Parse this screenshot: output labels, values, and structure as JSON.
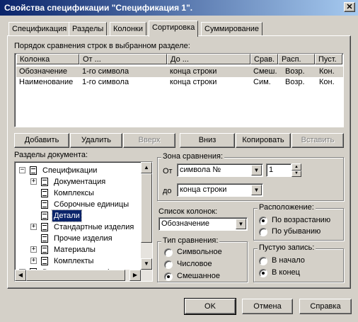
{
  "window": {
    "title": "Свойства спецификации \"Спецификация 1\".",
    "close_glyph": "✕"
  },
  "tabs": [
    {
      "label": "Спецификация",
      "active": false
    },
    {
      "label": "Разделы",
      "active": false
    },
    {
      "label": "Колонки",
      "active": false
    },
    {
      "label": "Сортировка",
      "active": true
    },
    {
      "label": "Суммирование",
      "active": false
    }
  ],
  "sort_table": {
    "caption": "Порядок сравнения строк в выбранном разделе:",
    "headers": [
      "Колонка",
      "От ...",
      "До ...",
      "Срав.",
      "Расп.",
      "Пуст."
    ],
    "rows": [
      [
        "Обозначение",
        "1-го символа",
        "конца строки",
        "Смеш.",
        "Возр.",
        "Кон."
      ],
      [
        "Наименование",
        "1-го символа",
        "конца строки",
        "Сим.",
        "Возр.",
        "Кон."
      ]
    ]
  },
  "buttons": {
    "add": "Добавить",
    "delete": "Удалить",
    "up": "Вверх",
    "down": "Вниз",
    "copy": "Копировать",
    "paste": "Вставить"
  },
  "sections_tree": {
    "label": "Разделы документа:",
    "root": "Спецификации",
    "items": [
      {
        "label": "Документация",
        "expandable": true,
        "selected": false
      },
      {
        "label": "Комплексы",
        "expandable": false,
        "selected": false
      },
      {
        "label": "Сборочные единицы",
        "expandable": false,
        "selected": false
      },
      {
        "label": "Детали",
        "expandable": false,
        "selected": true
      },
      {
        "label": "Стандартные изделия",
        "expandable": true,
        "selected": false
      },
      {
        "label": "Прочие изделия",
        "expandable": false,
        "selected": false
      },
      {
        "label": "Материалы",
        "expandable": true,
        "selected": false
      },
      {
        "label": "Комплекты",
        "expandable": true,
        "selected": false
      }
    ],
    "partial_next": "Ведомость спецификации"
  },
  "compare_zone": {
    "label": "Зона сравнения:",
    "from_label": "От",
    "from_value": "символа №",
    "from_number": "1",
    "to_label": "до",
    "to_value": "конца строки"
  },
  "column_list": {
    "label": "Список колонок:",
    "value": "Обозначение"
  },
  "compare_type": {
    "label": "Тип сравнения:",
    "options": [
      "Символьное",
      "Числовое",
      "Смешанное"
    ],
    "selected": 2
  },
  "order": {
    "label": "Расположение:",
    "options": [
      "По возрастанию",
      "По убыванию"
    ],
    "selected": 0
  },
  "empty_record": {
    "label": "Пустую запись:",
    "options": [
      "В начало",
      "В конец"
    ],
    "selected": 1
  },
  "dialog_buttons": {
    "ok": "OK",
    "cancel": "Отмена",
    "help": "Справка"
  }
}
